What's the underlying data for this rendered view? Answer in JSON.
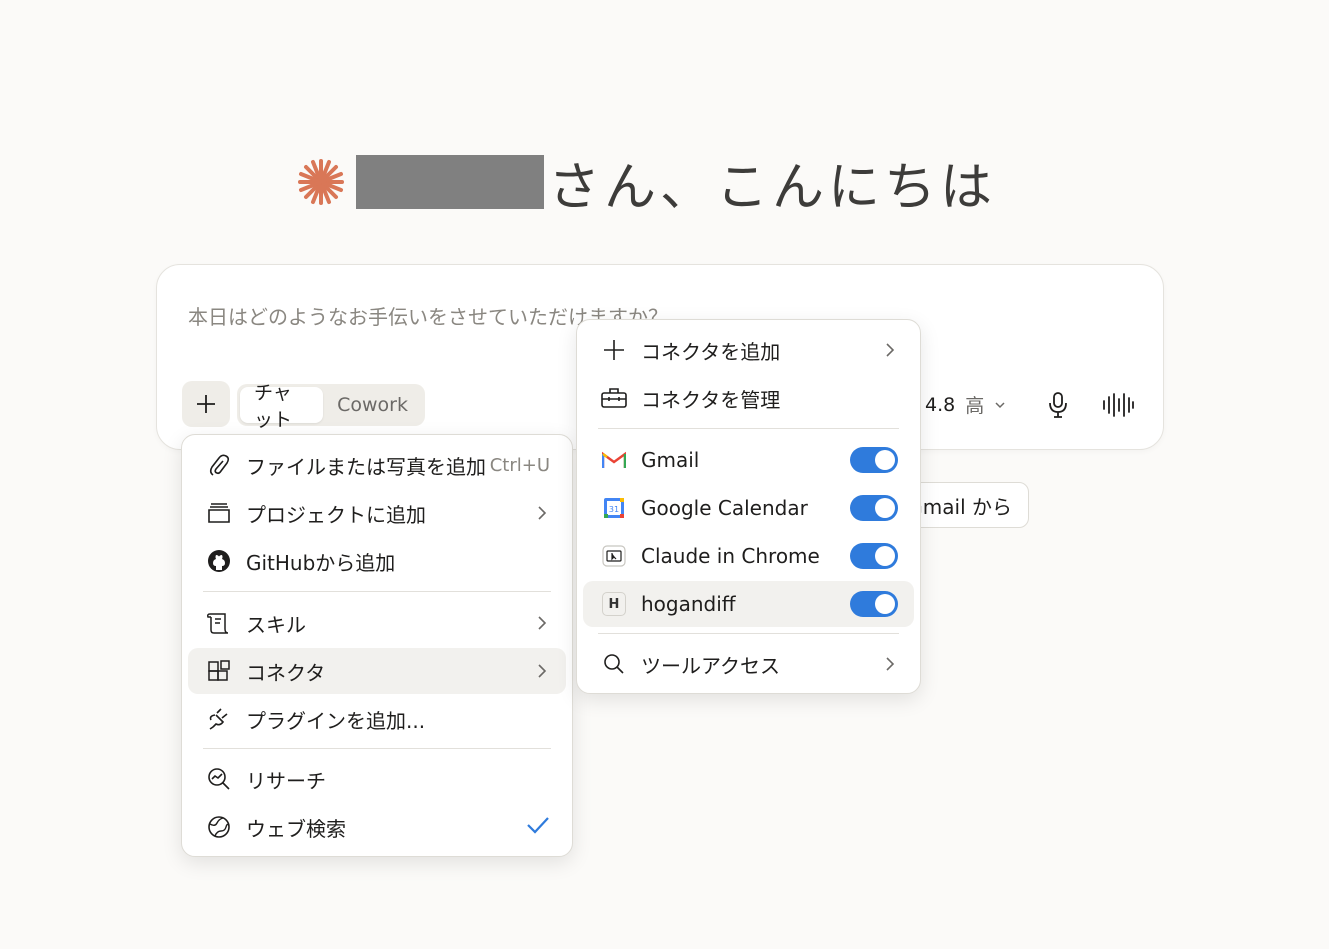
{
  "greeting": {
    "text": "さん、こんにちは"
  },
  "composer": {
    "placeholder": "本日はどのようなお手伝いをさせていただけますか？",
    "mode_chat": "チャット",
    "mode_cowork": "Cowork",
    "model_version": "4.8",
    "effort": "高"
  },
  "suggestion": {
    "label": "Gmail から"
  },
  "add_menu": {
    "items": [
      {
        "label": "ファイルまたは写真を追加",
        "shortcut": "Ctrl+U",
        "icon": "paperclip-icon"
      },
      {
        "label": "プロジェクトに追加",
        "icon": "project-icon"
      },
      {
        "label": "GitHubから追加",
        "icon": "github-icon"
      },
      {
        "label": "スキル",
        "icon": "skill-icon"
      },
      {
        "label": "コネクタ",
        "icon": "connector-icon"
      },
      {
        "label": "プラグインを追加...",
        "icon": "plug-icon"
      },
      {
        "label": "リサーチ",
        "icon": "research-icon"
      },
      {
        "label": "ウェブ検索",
        "icon": "globe-icon",
        "checked": true
      }
    ]
  },
  "connector_menu": {
    "add": "コネクタを追加",
    "manage": "コネクタを管理",
    "connectors": [
      {
        "label": "Gmail",
        "enabled": true
      },
      {
        "label": "Google Calendar",
        "enabled": true
      },
      {
        "label": "Claude in Chrome",
        "enabled": true
      },
      {
        "label": "hogandiff",
        "badge": "H",
        "enabled": true
      }
    ],
    "tool_access": "ツールアクセス"
  },
  "colors": {
    "accent": "#d97757",
    "toggle": "#2f7bdc",
    "check": "#2f7bdc"
  }
}
